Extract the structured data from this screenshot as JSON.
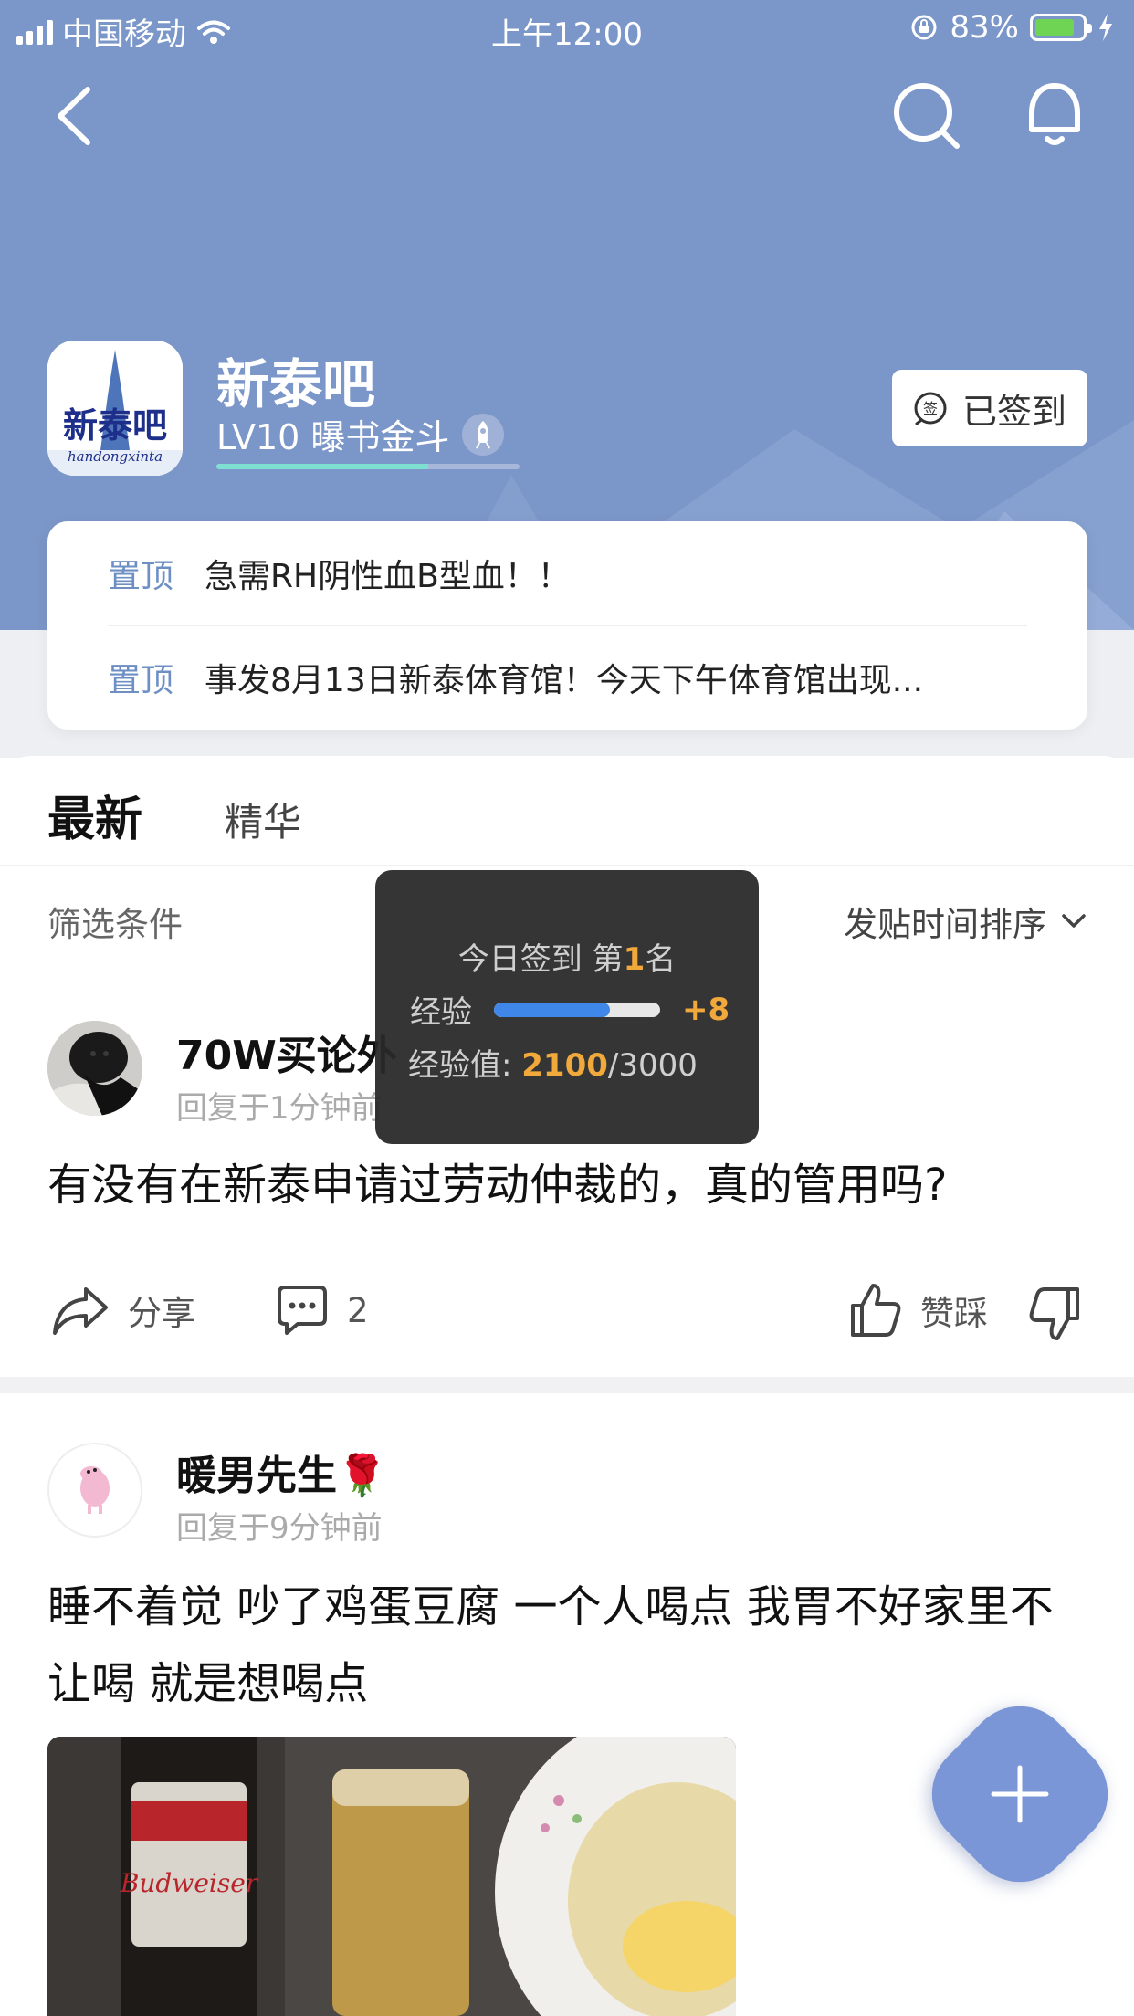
{
  "status_bar": {
    "carrier": "中国移动",
    "time": "上午12:00",
    "battery_percent": "83%",
    "battery_level": 0.83
  },
  "forum": {
    "name": "新泰吧",
    "level": "LV10 曝书金斗",
    "level_progress": 0.7,
    "signed_label": "已签到",
    "avatar_text": "新泰吧",
    "avatar_subtext": "handongxinta"
  },
  "pinned": [
    {
      "tag": "置顶",
      "text": "急需RH阴性血B型血！！"
    },
    {
      "tag": "置顶",
      "text": "事发8月13日新泰体育馆！今天下午体育馆出现..."
    }
  ],
  "tabs": {
    "latest": "最新",
    "featured": "精华"
  },
  "filter": {
    "label": "筛选条件",
    "sort": "发贴时间排序"
  },
  "popup": {
    "rank_prefix": "今日签到 第",
    "rank_num": "1",
    "rank_suffix": "名",
    "exp_label": "经验",
    "exp_gain": "+8",
    "exp_fill": 0.7,
    "total_label": "经验值: ",
    "total_current": "2100",
    "total_max": "/3000"
  },
  "posts": [
    {
      "username": "70W买论外",
      "time": "回复于1分钟前",
      "title": "有没有在新泰申请过劳动仲裁的，真的管用吗?",
      "share_label": "分享",
      "comment_count": "2",
      "vote_label": "赞踩"
    },
    {
      "username": "暖男先生🌹",
      "time": "回复于9分钟前",
      "title": "睡不着觉 吵了鸡蛋豆腐 一个人喝点 我胃不好家里不让喝 就是想喝点"
    }
  ],
  "colors": {
    "header": "#7b96c8",
    "accent": "#6e8fc4",
    "orange": "#f2a93b",
    "fab": "#7b96d6"
  },
  "icons": [
    "back-icon",
    "search-icon",
    "bell-icon",
    "sign-icon",
    "chevron-down-icon",
    "share-icon",
    "comment-icon",
    "thumbs-up-icon",
    "thumbs-down-icon",
    "plus-icon",
    "rocket-icon",
    "wifi-icon",
    "lock-rotation-icon",
    "charging-icon"
  ]
}
